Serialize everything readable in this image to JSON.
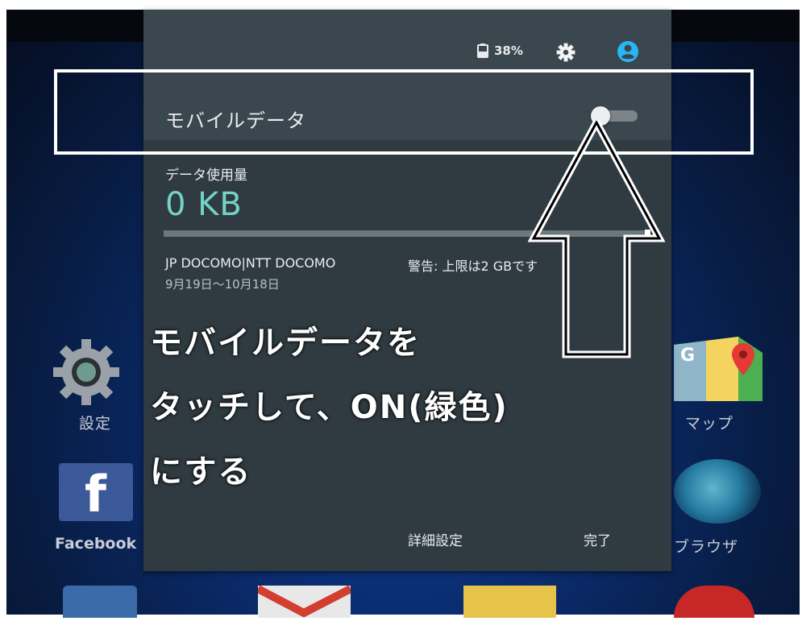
{
  "status": {
    "battery": "38%",
    "battery_icon": "battery-icon",
    "settings_icon": "settings-gear-icon",
    "account_icon": "account-circle-icon",
    "account_color": "#29b6f6"
  },
  "mobile_data": {
    "label": "モバイルデータ",
    "toggle_state": "off"
  },
  "usage": {
    "label": "データ使用量",
    "value": "0 KB",
    "progress": 0,
    "carrier": "JP DOCOMO|NTT DOCOMO",
    "warning": "警告: 上限は2 GBです",
    "period": "9月19日〜10月18日"
  },
  "actions": {
    "detail": "詳細設定",
    "done": "完了"
  },
  "instruction": {
    "line1": "モバイルデータを",
    "line2": "タッチして、ON(緑色)",
    "line3": "にする"
  },
  "home": {
    "settings_label": "設定",
    "facebook_label": "Facebook",
    "facebook_glyph": "f",
    "maps_label": "マップ",
    "browser_label": "ブラウザ"
  },
  "colors": {
    "panel_bg": "#2f3b41",
    "header_bg": "#3a474e",
    "accent": "#74d3c4"
  }
}
